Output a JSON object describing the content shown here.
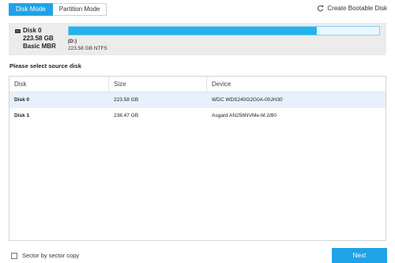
{
  "mode_tabs": [
    {
      "label": "Disk Mode",
      "active": true
    },
    {
      "label": "Partition Mode",
      "active": false
    }
  ],
  "header": {
    "bootable_label": "Create Bootable Disk",
    "bootable_icon": "refresh-icon"
  },
  "disk_panel": {
    "name": "Disk 0",
    "size": "223.58 GB",
    "type": "Basic MBR",
    "partition": {
      "letter": "(D:)",
      "detail": "223.58 GB NTFS",
      "used_fraction": 0.8
    }
  },
  "prompt": "Please select source disk",
  "table": {
    "columns": [
      "Disk",
      "Size",
      "Device"
    ],
    "rows": [
      {
        "disk": "Disk 0",
        "size": "223.58 GB",
        "device": "WDC WDS240G2G0A-00JH30",
        "selected": true
      },
      {
        "disk": "Disk 1",
        "size": "238.47 GB",
        "device": "Asgard AN256NVMe-M.2/80",
        "selected": false
      }
    ]
  },
  "footer": {
    "sector_copy_label": "Sector by sector copy",
    "sector_copy_checked": false,
    "next_label": "Next"
  },
  "colors": {
    "accent": "#1fa3e6",
    "bar_fill": "#23b2ec",
    "selected_row": "#e7f1fb"
  }
}
